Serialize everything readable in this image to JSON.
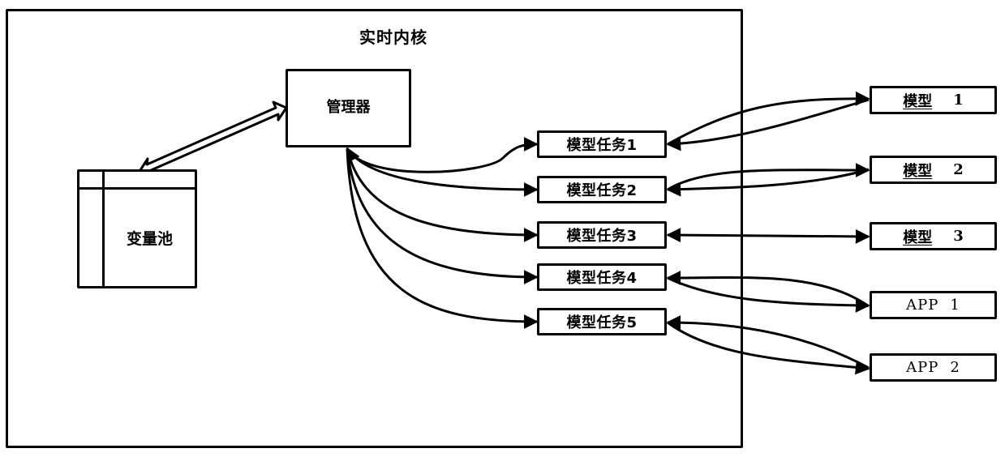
{
  "diagram": {
    "kernel": {
      "title": "实时内核"
    },
    "manager": {
      "label": "管理器"
    },
    "variable_pool": {
      "label": "变量池"
    },
    "tasks": [
      {
        "label": "模型任务1"
      },
      {
        "label": "模型任务2"
      },
      {
        "label": "模型任务3"
      },
      {
        "label": "模型任务4"
      },
      {
        "label": "模型任务5"
      }
    ],
    "targets": [
      {
        "name": "模型",
        "number": "1",
        "kind": "model"
      },
      {
        "name": "模型",
        "number": "2",
        "kind": "model"
      },
      {
        "name": "模型",
        "number": "3",
        "kind": "model"
      },
      {
        "name": "APP",
        "number": "1",
        "kind": "app"
      },
      {
        "name": "APP",
        "number": "2",
        "kind": "app"
      }
    ],
    "connections": [
      {
        "from": "variable_pool",
        "to": "manager",
        "style": "hollow-double-arrow"
      },
      {
        "from": "manager",
        "to": "模型任务1",
        "style": "bidirectional"
      },
      {
        "from": "manager",
        "to": "模型任务2",
        "style": "bidirectional"
      },
      {
        "from": "manager",
        "to": "模型任务3",
        "style": "bidirectional"
      },
      {
        "from": "manager",
        "to": "模型任务4",
        "style": "bidirectional"
      },
      {
        "from": "manager",
        "to": "模型任务5",
        "style": "bidirectional"
      },
      {
        "from": "模型任务1",
        "to": "模型 1",
        "style": "two-curves"
      },
      {
        "from": "模型任务2",
        "to": "模型 2",
        "style": "two-curves"
      },
      {
        "from": "模型任务3",
        "to": "模型 3",
        "style": "straight-double"
      },
      {
        "from": "模型任务4",
        "to": "APP 1",
        "style": "two-curves"
      },
      {
        "from": "模型任务5",
        "to": "APP 2",
        "style": "two-curves"
      }
    ]
  }
}
